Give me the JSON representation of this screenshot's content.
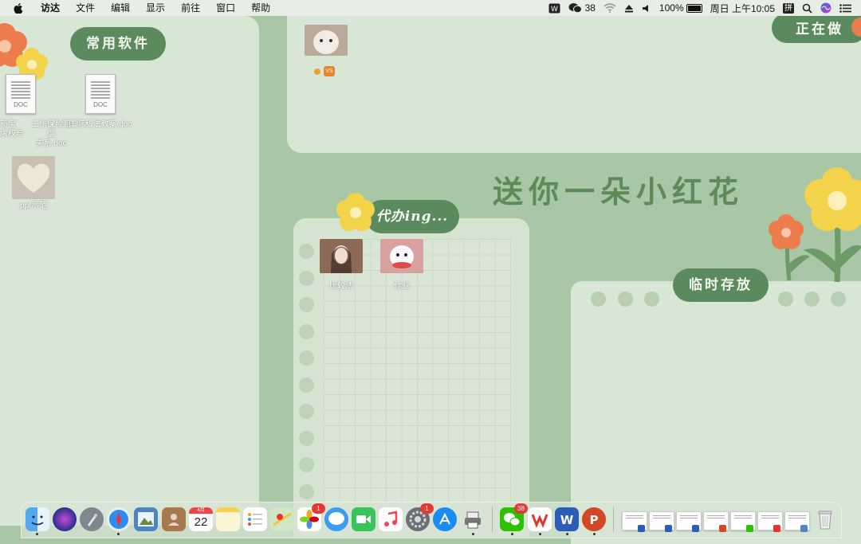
{
  "menubar": {
    "app_name": "访达",
    "menus": [
      "文件",
      "编辑",
      "显示",
      "前往",
      "窗口",
      "帮助"
    ],
    "wechat_count": "38",
    "battery": "100%",
    "clock": "周日 上午10:05",
    "input_method": "拼"
  },
  "wallpaper": {
    "common_software": "常用软件",
    "in_progress": "正在做",
    "todo": "代办ing...",
    "temp_storage": "临时存放",
    "headline": "送你一朵小红花"
  },
  "desktop": {
    "icons": [
      {
        "label_line1": "新宝",
        "label_line2": "求权与",
        "kind": "doc-file"
      },
      {
        "label_line1": "工伤保险赔偿",
        "label_line2": "关系.doc",
        "kind": "doc-file"
      },
      {
        "label": "国际私法教案.doc",
        "kind": "doc-file"
      },
      {
        "label": "ppt示范",
        "kind": "image-thumbnail"
      },
      {
        "label": "比较法",
        "kind": "image-thumbnail"
      },
      {
        "label": "作业",
        "kind": "image-thumbnail"
      },
      {
        "label": "",
        "kind": "image-thumbnail"
      }
    ],
    "doc_tag": "DOC",
    "vs_badge": "VS"
  },
  "dock": {
    "calendar_month": "4月",
    "calendar_day": "22",
    "photos_badge": "1",
    "settings_badge": "1",
    "wechat_badge": "38",
    "items": [
      "finder",
      "siri",
      "launchpad",
      "safari",
      "preview",
      "contacts",
      "calendar",
      "notes",
      "reminders",
      "maps",
      "photos",
      "messages",
      "facetime",
      "music",
      "system-preferences",
      "app-store",
      "printer",
      "wechat",
      "wps",
      "word",
      "powerpoint",
      "trash"
    ]
  },
  "colors": {
    "menubar_bg": "#e8eee6",
    "wallpaper_green": "#a9c6a6",
    "panel": "#d8e6d5",
    "pill": "#5a8a5d",
    "headline": "#5d8a56",
    "flower_yellow": "#f3d34a",
    "flower_orange": "#ec7c4c"
  }
}
